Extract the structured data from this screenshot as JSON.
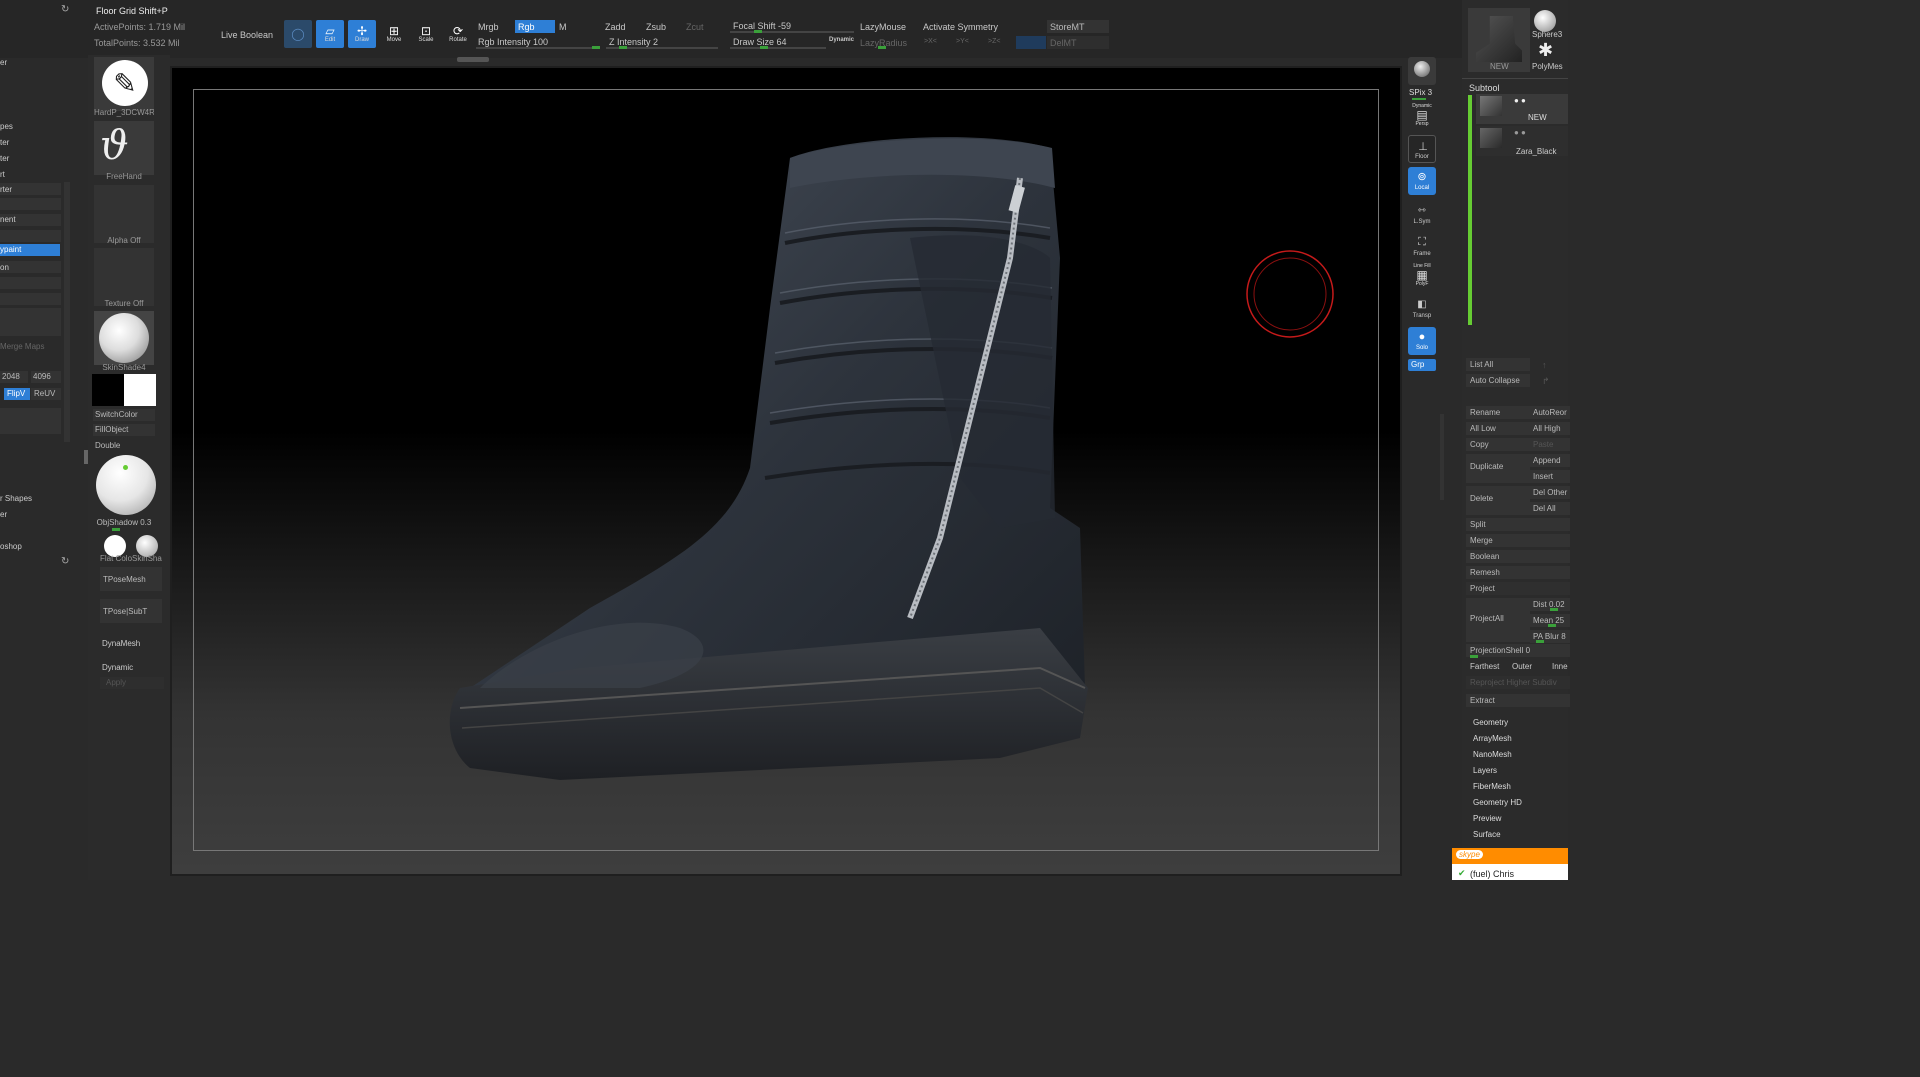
{
  "topbar": {
    "floor_grid": "Floor Grid Shift+P",
    "active_points": "ActivePoints: 1.719 Mil",
    "total_points": "TotalPoints: 3.532 Mil",
    "live_boolean": "Live Boolean",
    "tools": [
      {
        "label": "Edit",
        "icon": "edit-icon"
      },
      {
        "label": "Draw",
        "icon": "draw-icon"
      },
      {
        "label": "Move",
        "icon": "move-icon"
      },
      {
        "label": "Scale",
        "icon": "scale-icon"
      },
      {
        "label": "Rotate",
        "icon": "rotate-icon"
      }
    ],
    "mrgb": "Mrgb",
    "rgb": "Rgb",
    "m": "M",
    "zadd": "Zadd",
    "zsub": "Zsub",
    "zcut": "Zcut",
    "rgb_intensity": "Rgb Intensity 100",
    "z_intensity": "Z Intensity 2",
    "focal_shift": "Focal Shift -59",
    "draw_size": "Draw Size 64",
    "dynamic": "Dynamic",
    "lazymouse": "LazyMouse",
    "lazyradius": "LazyRadius",
    "activate_symmetry": "Activate Symmetry",
    "sym_x": ">X<",
    "sym_y": ">Y<",
    "sym_z": ">Z<",
    "storemt": "StoreMT",
    "delmt": "DelMT"
  },
  "left_panel": {
    "items": [
      "er",
      "pes",
      "ter",
      "ter",
      "rt",
      "rter",
      "nent",
      "ypaint",
      "on",
      "Merge Maps",
      "r Shapes",
      "er",
      "oshop"
    ],
    "res_a": "2048",
    "res_b": "4096",
    "flipv": "FlipV",
    "reuv": "ReUV"
  },
  "tool_column": {
    "brush": "HardP_3DCW4RI",
    "stroke": "FreeHand",
    "alpha": "Alpha Off",
    "texture": "Texture Off",
    "material": "SkinShade4",
    "switch_color": "SwitchColor",
    "fill_object": "FillObject",
    "double": "Double",
    "obj_shadow": "ObjShadow 0.3",
    "flat_color": "Flat Colo",
    "skin_sha": "SkinSha",
    "tpose_mesh": "TPoseMesh",
    "tpose_subt": "TPose|SubT",
    "dynamesh": "DynaMesh",
    "dynamic": "Dynamic",
    "apply": "Apply"
  },
  "right_shelf": {
    "items": [
      {
        "label": "BPR",
        "icon": "bpr-icon"
      },
      {
        "label": "SPix 3",
        "icon": ""
      },
      {
        "label": "Persp",
        "icon": "persp-icon"
      },
      {
        "label": "Floor",
        "icon": "floor-icon"
      },
      {
        "label": "Local",
        "icon": "local-icon"
      },
      {
        "label": "L.Sym",
        "icon": "lsym-icon"
      },
      {
        "label": "Frame",
        "icon": "frame-icon"
      },
      {
        "label": "PolyF",
        "icon": "polyf-icon"
      },
      {
        "label": "Transp",
        "icon": "transp-icon"
      },
      {
        "label": "Solo",
        "icon": "solo-icon"
      },
      {
        "label": "Grp",
        "icon": ""
      }
    ],
    "dynamic": "Dynamic",
    "line_fill": "Line Fill"
  },
  "right_panel": {
    "new_label": "NEW",
    "sphere_label": "Sphere3",
    "polymesh_label": "PolyMes",
    "subtool_title": "Subtool",
    "subtools": [
      "NEW",
      "Zara_Black"
    ],
    "list_all": "List All",
    "auto_collapse": "Auto Collapse",
    "rename": "Rename",
    "autoreorder": "AutoReor",
    "all_low": "All Low",
    "all_high": "All High",
    "copy": "Copy",
    "paste": "Paste",
    "duplicate": "Duplicate",
    "append": "Append",
    "insert": "Insert",
    "delete": "Delete",
    "del_other": "Del Other",
    "del_all": "Del All",
    "split": "Split",
    "merge": "Merge",
    "boolean": "Boolean",
    "remesh": "Remesh",
    "project": "Project",
    "project_all": "ProjectAll",
    "dist": "Dist 0.02",
    "mean": "Mean 25",
    "pa_blur": "PA Blur 8",
    "projection_shell": "ProjectionShell 0",
    "farthest": "Farthest",
    "outer": "Outer",
    "inner": "Inne",
    "reproject": "Reproject Higher Subdiv",
    "extract": "Extract",
    "menus": [
      "Geometry",
      "ArrayMesh",
      "NanoMesh",
      "Layers",
      "FiberMesh",
      "Geometry HD",
      "Preview",
      "Surface"
    ]
  },
  "skype": {
    "brand": "skype",
    "contact": "(fuel) Chris"
  },
  "colors": {
    "accent": "#2e7fd6",
    "slider": "#3aa03a",
    "brush_cursor": "#c41a1a",
    "skype_orange": "#ff8c00"
  }
}
